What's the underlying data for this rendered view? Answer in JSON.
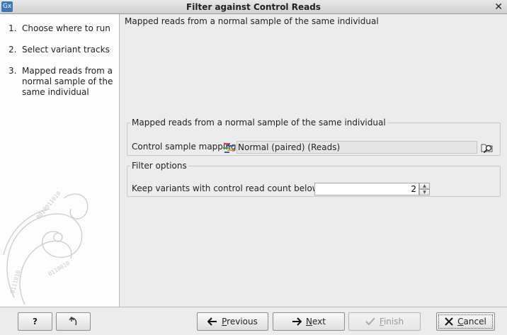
{
  "window": {
    "title": "Filter against Control Reads",
    "app_icon_text": "Gx",
    "close_glyph": "✕"
  },
  "steps": [
    {
      "num": "1.",
      "label": "Choose where to run"
    },
    {
      "num": "2.",
      "label": "Select variant tracks"
    },
    {
      "num": "3.",
      "label": "Mapped reads from a normal sample of the same individual"
    }
  ],
  "main": {
    "page_title": "Mapped reads from a normal sample of the same individual",
    "mapping_group": {
      "legend": "Mapped reads from a normal sample of the same individual",
      "label": "Control sample mapping",
      "value": "Normal (paired) (Reads)",
      "icon": "reads-track-icon",
      "browse_icon": "browse-folder-icon"
    },
    "filter_group": {
      "legend": "Filter options",
      "label": "Keep variants with control read count below",
      "value": "2"
    }
  },
  "buttons": {
    "help": "?",
    "reset_icon": "reset-arrow-icon",
    "previous": {
      "mnemonic": "P",
      "rest": "revious"
    },
    "next": {
      "mnemonic": "N",
      "rest": "ext"
    },
    "finish": {
      "mnemonic": "F",
      "rest": "inish"
    },
    "cancel": {
      "mnemonic": "C",
      "rest": "ancel"
    }
  },
  "colors": {
    "accent": "#1a4f9c",
    "close_red": "#c00000"
  }
}
